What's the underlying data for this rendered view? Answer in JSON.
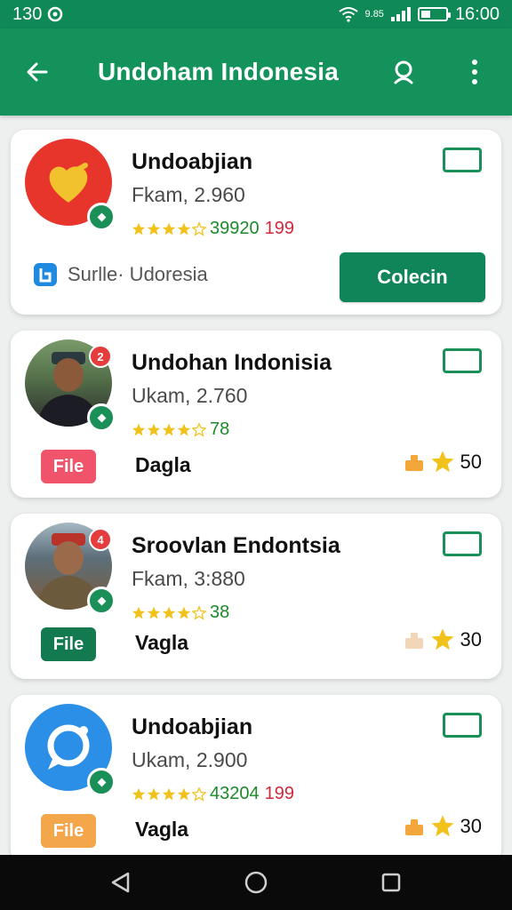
{
  "status_bar": {
    "left_text": "130",
    "net_small": "9.85",
    "time": "16:00"
  },
  "app_bar": {
    "title": "Undoham Indonesia"
  },
  "items": [
    {
      "name": "Undoabjian",
      "subtitle": "Fkam, 2.960",
      "rating_count": "39920",
      "rating_extra": "199",
      "source_label": "Surlle·  Udoresia",
      "button_label": "Colecin",
      "avatar": "orange-heart-logo",
      "avatar_color": "#e8352b"
    },
    {
      "name": "Undohan Indonisia",
      "subtitle": "Ukam, 2.760",
      "rating_count": "78",
      "badge": "2",
      "file_label": "File",
      "label": "Dagla",
      "meta_value": "50",
      "avatar": "man-photo"
    },
    {
      "name": "Sroovlan Endontsia",
      "subtitle": "Fkam, 3:880",
      "rating_count": "38",
      "badge": "4",
      "file_label": "File",
      "label": "Vagla",
      "meta_value": "30",
      "avatar": "man-photo-2"
    },
    {
      "name": "Undoabjian",
      "subtitle": "Ukam, 2.900",
      "rating_count": "43204",
      "rating_extra": "199",
      "file_label": "File",
      "label": "Vagla",
      "meta_value": "30",
      "avatar": "blue-chat-logo",
      "avatar_color": "#2b8fe8"
    }
  ],
  "colors": {
    "primary": "#13935b",
    "star": "#f1c21b"
  }
}
